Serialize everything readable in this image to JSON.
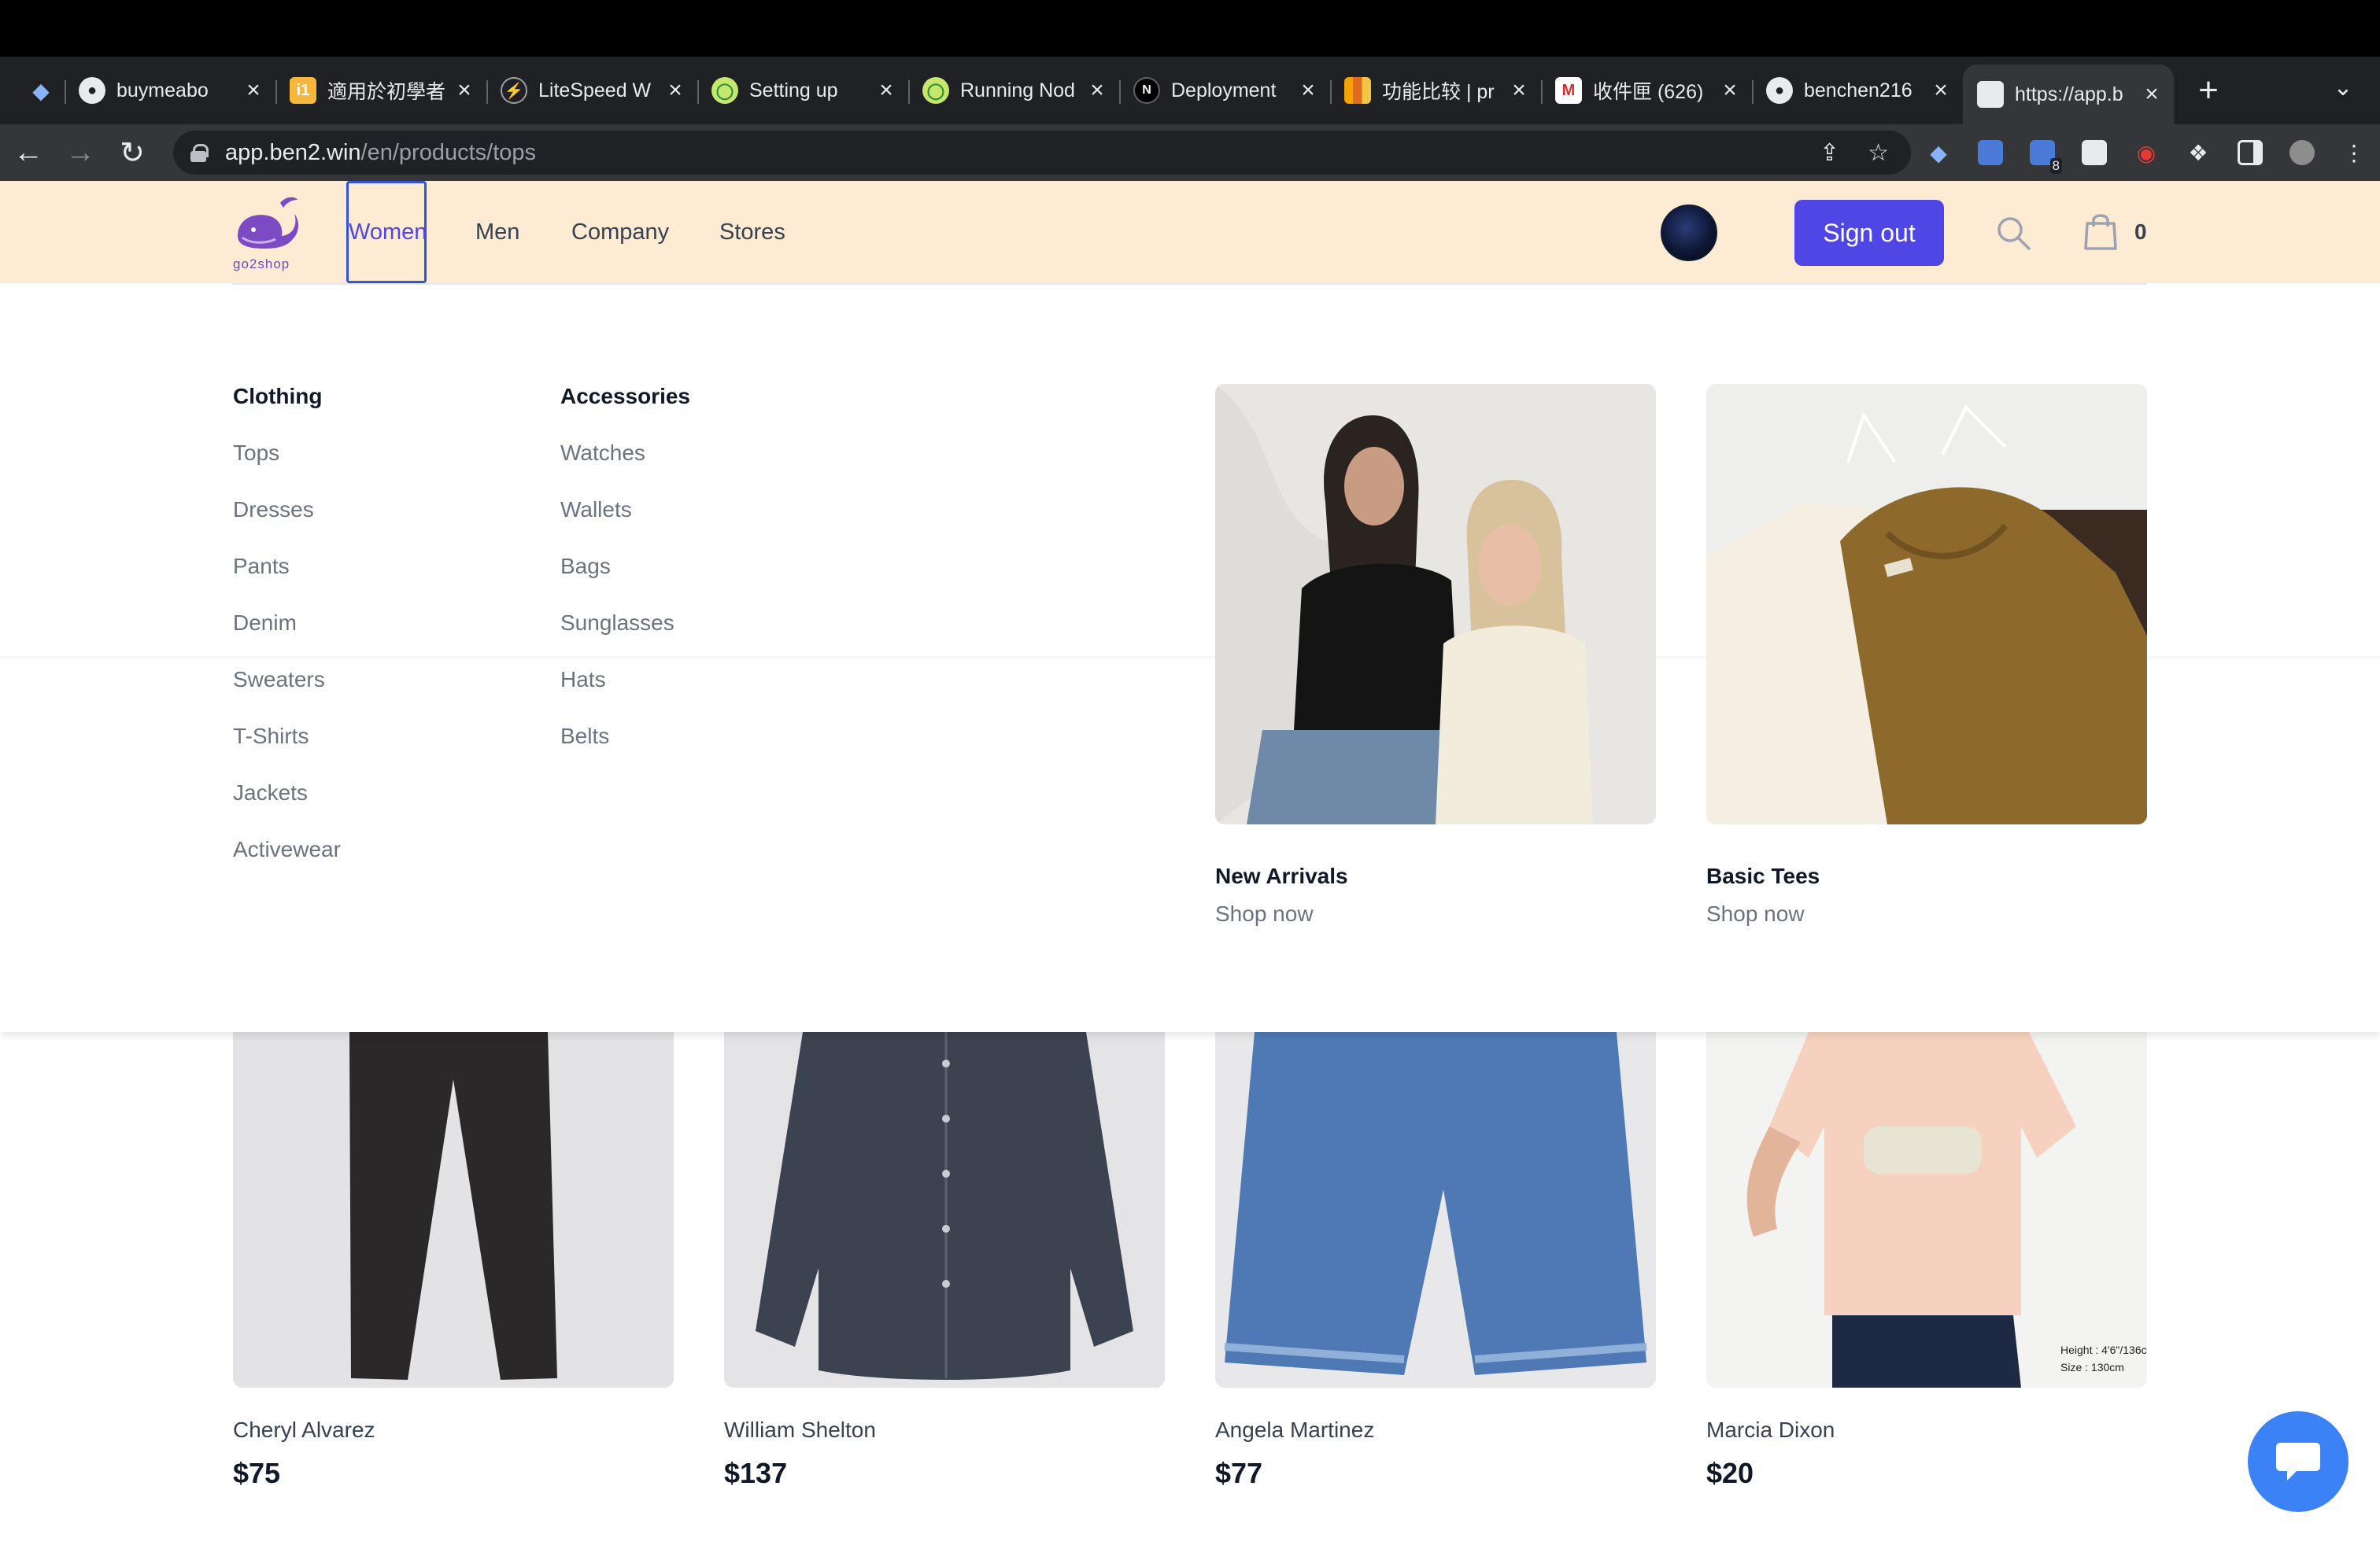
{
  "browser": {
    "tabs": [
      {
        "title": "buymeabo",
        "favicon": "github-icon"
      },
      {
        "title": "適用於初學者",
        "favicon": "itel-icon"
      },
      {
        "title": "LiteSpeed W",
        "favicon": "litespeed-icon"
      },
      {
        "title": "Setting up",
        "favicon": "setup-icon"
      },
      {
        "title": "Running Nod",
        "favicon": "setup-icon"
      },
      {
        "title": "Deployment",
        "favicon": "nextjs-icon"
      },
      {
        "title": "功能比较 | pr",
        "favicon": "grid-icon"
      },
      {
        "title": "收件匣 (626)",
        "favicon": "gmail-icon"
      },
      {
        "title": "benchen216",
        "favicon": "github-icon"
      },
      {
        "title": "https://app.b",
        "favicon": "page-icon"
      }
    ],
    "url_host": "app.ben2.win",
    "url_path": "/en/products/tops",
    "extension_badge": "8"
  },
  "store": {
    "logo_text": "go2shop",
    "nav": [
      "Women",
      "Men",
      "Company",
      "Stores"
    ],
    "sign_out": "Sign out",
    "cart_count": "0"
  },
  "menu": {
    "clothing": {
      "title": "Clothing",
      "items": [
        "Tops",
        "Dresses",
        "Pants",
        "Denim",
        "Sweaters",
        "T-Shirts",
        "Jackets",
        "Activewear"
      ]
    },
    "accessories": {
      "title": "Accessories",
      "items": [
        "Watches",
        "Wallets",
        "Bags",
        "Sunglasses",
        "Hats",
        "Belts"
      ]
    },
    "featured": [
      {
        "title": "New Arrivals",
        "cta": "Shop now"
      },
      {
        "title": "Basic Tees",
        "cta": "Shop now"
      }
    ]
  },
  "products": [
    {
      "name": "Cheryl Alvarez",
      "price": "$75"
    },
    {
      "name": "William Shelton",
      "price": "$137"
    },
    {
      "name": "Angela Martinez",
      "price": "$77"
    },
    {
      "name": "Marcia Dixon",
      "price": "$20"
    }
  ],
  "product_tag": {
    "height": "Height : 4'6\"/136c",
    "size": "Size : 130cm"
  },
  "colors": {
    "accent": "#4f46e5",
    "header_bg": "#fdebd3",
    "chat": "#3b82f6"
  }
}
